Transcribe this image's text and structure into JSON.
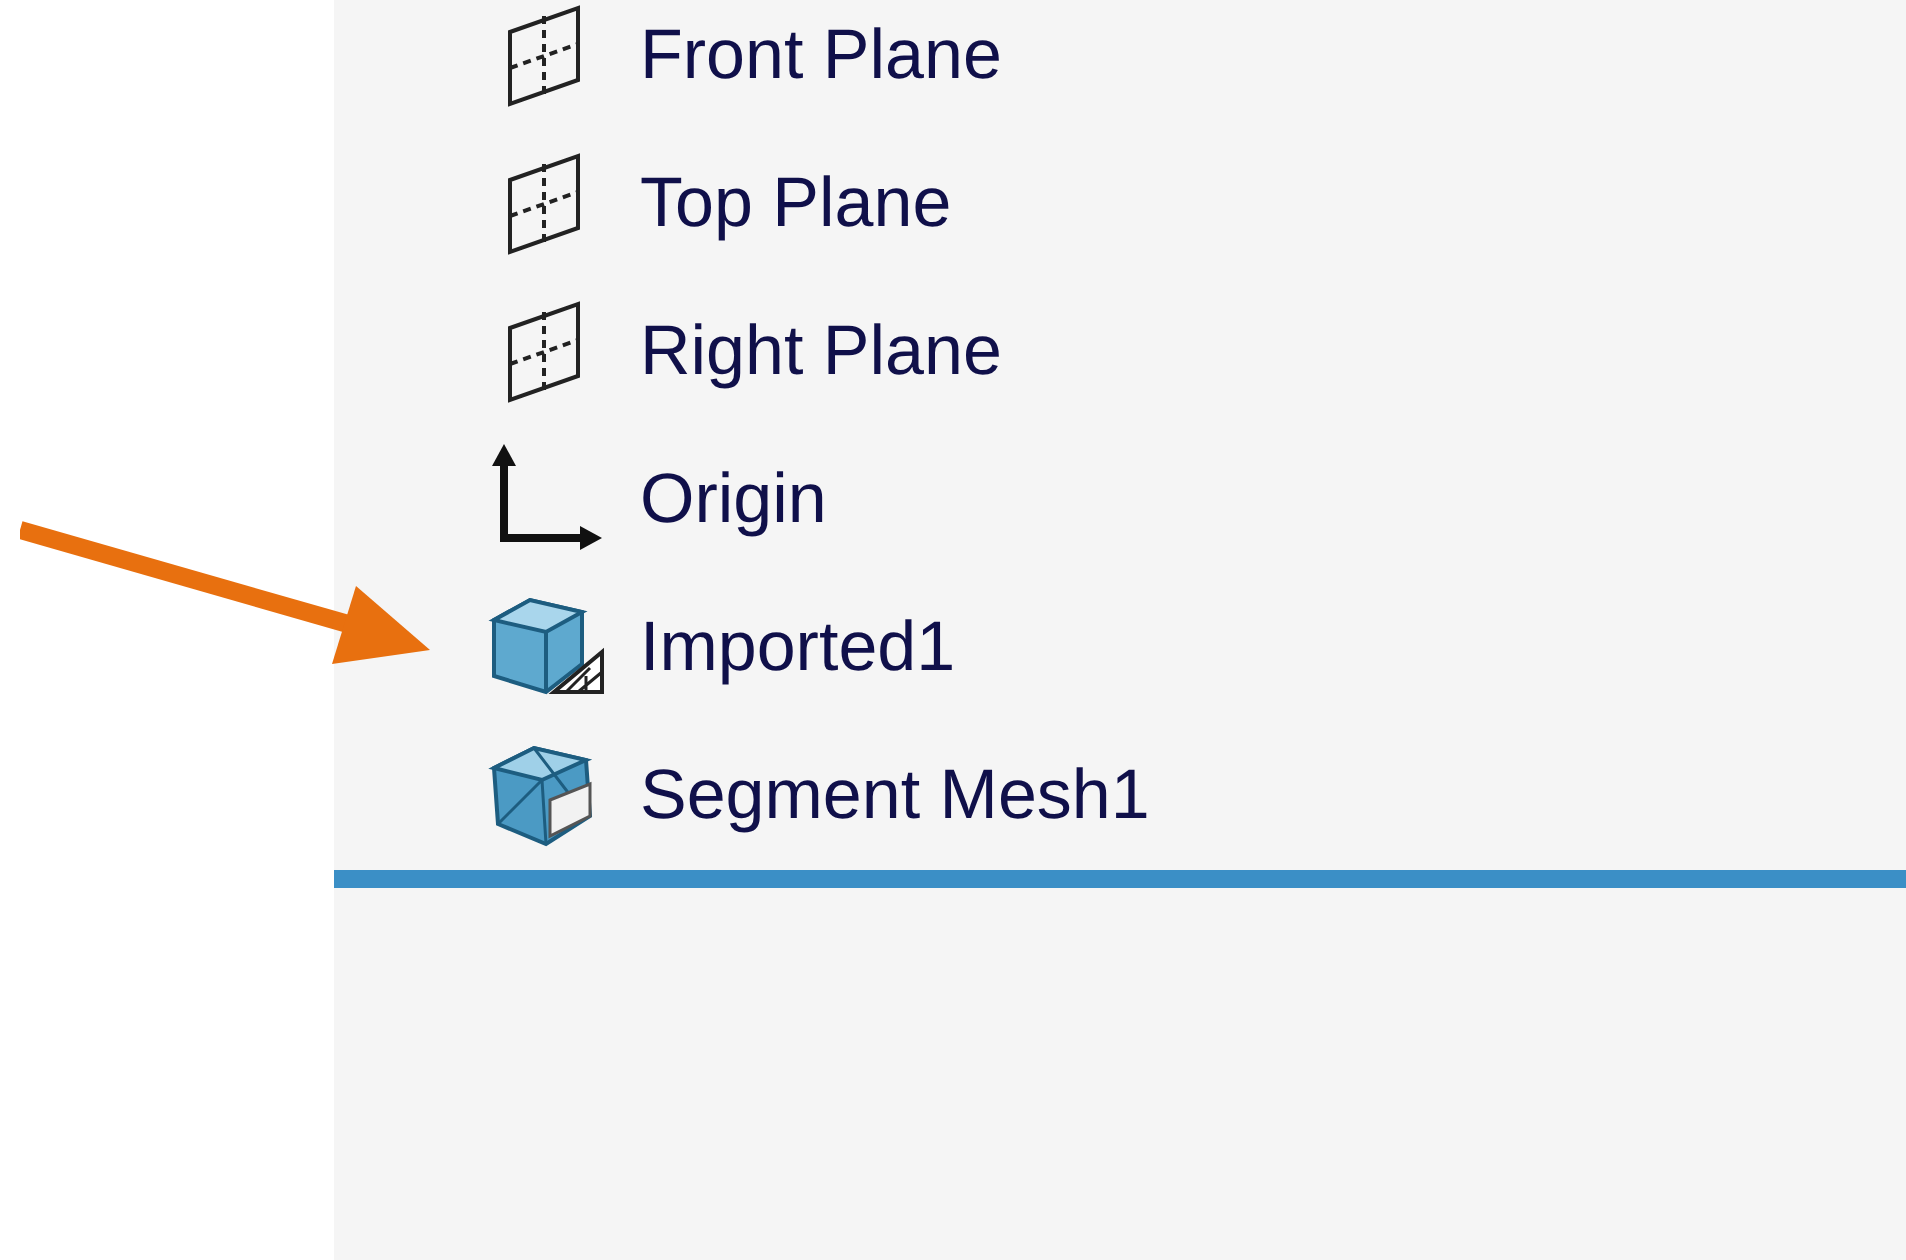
{
  "tree": {
    "items": [
      {
        "label": "Front Plane",
        "kind": "plane",
        "pointed": false
      },
      {
        "label": "Top Plane",
        "kind": "plane",
        "pointed": false
      },
      {
        "label": "Right Plane",
        "kind": "plane",
        "pointed": false
      },
      {
        "label": "Origin",
        "kind": "origin",
        "pointed": false
      },
      {
        "label": "Imported1",
        "kind": "imported",
        "pointed": true
      },
      {
        "label": "Segment Mesh1",
        "kind": "mesh",
        "pointed": false
      }
    ]
  }
}
